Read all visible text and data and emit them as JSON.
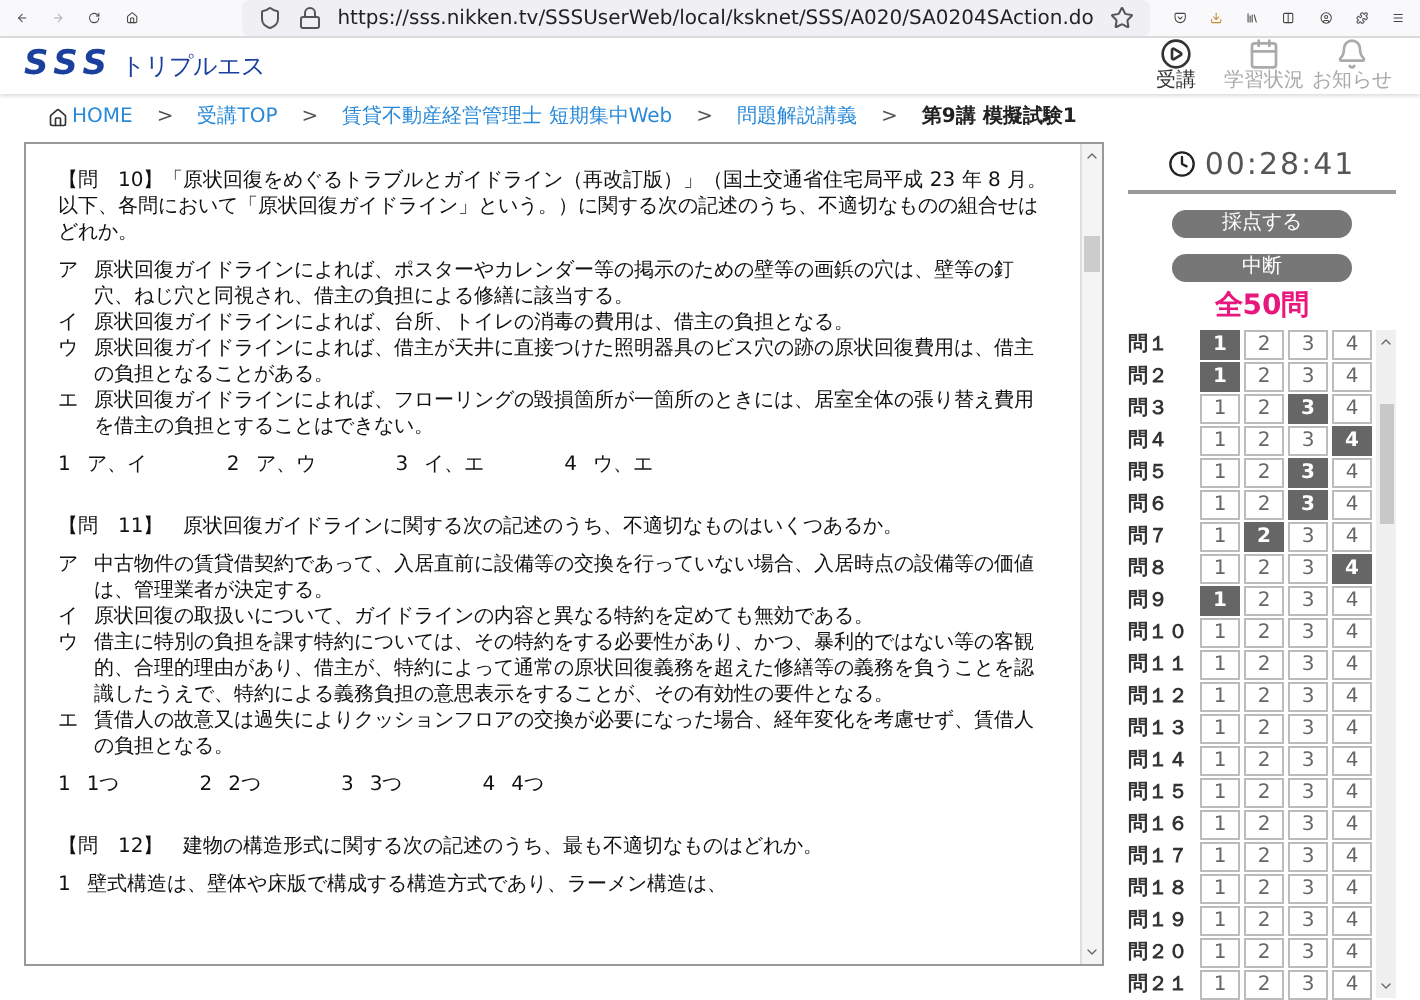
{
  "browser": {
    "url": "https://sss.nikken.tv/SSSUserWeb/local/ksknet/SSS/A020/SA0204SAction.do"
  },
  "header": {
    "logo_mark": "SSS",
    "logo_text": "トリプルエス",
    "nav": [
      {
        "label": "受講",
        "kind": "video",
        "disabled": false
      },
      {
        "label": "学習状況",
        "kind": "calendar",
        "disabled": true
      },
      {
        "label": "お知らせ",
        "kind": "bell",
        "disabled": true
      }
    ]
  },
  "breadcrumb": {
    "items": [
      {
        "label": "HOME",
        "kind": "home",
        "current": false
      },
      {
        "label": "受講TOP",
        "kind": "link",
        "current": false
      },
      {
        "label": "賃貸不動産経営管理士 短期集中Web",
        "kind": "link",
        "current": false
      },
      {
        "label": "問題解説講義",
        "kind": "link",
        "current": false
      },
      {
        "label": "第9講 模擬試験1",
        "kind": "link",
        "current": true
      }
    ],
    "separators": [
      ">",
      ">",
      ">",
      ">"
    ]
  },
  "document": {
    "questions": [
      {
        "prompt": "【問　10】「原状回復をめぐるトラブルとガイドライン（再改訂版）」（国土交通省住宅局平成 23 年 8 月。以下、各問において「原状回復ガイドライン」という。）に関する次の記述のうち、不適切なものの組合せはどれか。",
        "statements": [
          {
            "mark": "ア",
            "text": "原状回復ガイドラインによれば、ポスターやカレンダー等の掲示のための壁等の画鋲の穴は、壁等の釘穴、ねじ穴と同視され、借主の負担による修繕に該当する。"
          },
          {
            "mark": "イ",
            "text": "原状回復ガイドラインによれば、台所、トイレの消毒の費用は、借主の負担となる。"
          },
          {
            "mark": "ウ",
            "text": "原状回復ガイドラインによれば、借主が天井に直接つけた照明器具のビス穴の跡の原状回復費用は、借主の負担となることがある。"
          },
          {
            "mark": "エ",
            "text": "原状回復ガイドラインによれば、フローリングの毀損箇所が一箇所のときには、居室全体の張り替え費用を借主の負担とすることはできない。"
          }
        ],
        "options": [
          {
            "number": "1",
            "text": "ア、イ"
          },
          {
            "number": "2",
            "text": "ア、ウ"
          },
          {
            "number": "3",
            "text": "イ、エ"
          },
          {
            "number": "4",
            "text": "ウ、エ"
          }
        ]
      },
      {
        "prompt": "【問　11】　原状回復ガイドラインに関する次の記述のうち、不適切なものはいくつあるか。",
        "statements": [
          {
            "mark": "ア",
            "text": "中古物件の賃貸借契約であって、入居直前に設備等の交換を行っていない場合、入居時点の設備等の価値は、管理業者が決定する。"
          },
          {
            "mark": "イ",
            "text": "原状回復の取扱いについて、ガイドラインの内容と異なる特約を定めても無効である。"
          },
          {
            "mark": "ウ",
            "text": "借主に特別の負担を課す特約については、その特約をする必要性があり、かつ、暴利的ではない等の客観的、合理的理由があり、借主が、特約によって通常の原状回復義務を超えた修繕等の義務を負うことを認識したうえで、特約による義務負担の意思表示をすることが、その有効性の要件となる。"
          },
          {
            "mark": "エ",
            "text": "賃借人の故意又は過失によりクッションフロアの交換が必要になった場合、経年変化を考慮せず、賃借人の負担となる。"
          }
        ],
        "options": [
          {
            "number": "1",
            "text": "1つ"
          },
          {
            "number": "2",
            "text": "2つ"
          },
          {
            "number": "3",
            "text": "3つ"
          },
          {
            "number": "4",
            "text": "4つ"
          }
        ]
      },
      {
        "prompt": "【問　12】　建物の構造形式に関する次の記述のうち、最も不適切なものはどれか。",
        "options": [
          {
            "number": "1",
            "text": "壁式構造は、壁体や床版で構成する構造方式であり、ラーメン構造は、"
          }
        ]
      }
    ]
  },
  "timer": "00:28:41",
  "buttons": [
    {
      "label": "採点する"
    },
    {
      "label": "中断"
    }
  ],
  "total": "全50問",
  "answers": [
    {
      "label": "問１",
      "choices": [
        {
          "label": "1",
          "selected": true
        },
        {
          "label": "2",
          "selected": false
        },
        {
          "label": "3",
          "selected": false
        },
        {
          "label": "4",
          "selected": false
        }
      ]
    },
    {
      "label": "問２",
      "choices": [
        {
          "label": "1",
          "selected": true
        },
        {
          "label": "2",
          "selected": false
        },
        {
          "label": "3",
          "selected": false
        },
        {
          "label": "4",
          "selected": false
        }
      ]
    },
    {
      "label": "問３",
      "choices": [
        {
          "label": "1",
          "selected": false
        },
        {
          "label": "2",
          "selected": false
        },
        {
          "label": "3",
          "selected": true
        },
        {
          "label": "4",
          "selected": false
        }
      ]
    },
    {
      "label": "問４",
      "choices": [
        {
          "label": "1",
          "selected": false
        },
        {
          "label": "2",
          "selected": false
        },
        {
          "label": "3",
          "selected": false
        },
        {
          "label": "4",
          "selected": true
        }
      ]
    },
    {
      "label": "問５",
      "choices": [
        {
          "label": "1",
          "selected": false
        },
        {
          "label": "2",
          "selected": false
        },
        {
          "label": "3",
          "selected": true
        },
        {
          "label": "4",
          "selected": false
        }
      ]
    },
    {
      "label": "問６",
      "choices": [
        {
          "label": "1",
          "selected": false
        },
        {
          "label": "2",
          "selected": false
        },
        {
          "label": "3",
          "selected": true
        },
        {
          "label": "4",
          "selected": false
        }
      ]
    },
    {
      "label": "問７",
      "choices": [
        {
          "label": "1",
          "selected": false
        },
        {
          "label": "2",
          "selected": true
        },
        {
          "label": "3",
          "selected": false
        },
        {
          "label": "4",
          "selected": false
        }
      ]
    },
    {
      "label": "問８",
      "choices": [
        {
          "label": "1",
          "selected": false
        },
        {
          "label": "2",
          "selected": false
        },
        {
          "label": "3",
          "selected": false
        },
        {
          "label": "4",
          "selected": true
        }
      ]
    },
    {
      "label": "問９",
      "choices": [
        {
          "label": "1",
          "selected": true
        },
        {
          "label": "2",
          "selected": false
        },
        {
          "label": "3",
          "selected": false
        },
        {
          "label": "4",
          "selected": false
        }
      ]
    },
    {
      "label": "問１０",
      "choices": [
        {
          "label": "1",
          "selected": false
        },
        {
          "label": "2",
          "selected": false
        },
        {
          "label": "3",
          "selected": false
        },
        {
          "label": "4",
          "selected": false
        }
      ]
    },
    {
      "label": "問１１",
      "choices": [
        {
          "label": "1",
          "selected": false
        },
        {
          "label": "2",
          "selected": false
        },
        {
          "label": "3",
          "selected": false
        },
        {
          "label": "4",
          "selected": false
        }
      ]
    },
    {
      "label": "問１２",
      "choices": [
        {
          "label": "1",
          "selected": false
        },
        {
          "label": "2",
          "selected": false
        },
        {
          "label": "3",
          "selected": false
        },
        {
          "label": "4",
          "selected": false
        }
      ]
    },
    {
      "label": "問１３",
      "choices": [
        {
          "label": "1",
          "selected": false
        },
        {
          "label": "2",
          "selected": false
        },
        {
          "label": "3",
          "selected": false
        },
        {
          "label": "4",
          "selected": false
        }
      ]
    },
    {
      "label": "問１４",
      "choices": [
        {
          "label": "1",
          "selected": false
        },
        {
          "label": "2",
          "selected": false
        },
        {
          "label": "3",
          "selected": false
        },
        {
          "label": "4",
          "selected": false
        }
      ]
    },
    {
      "label": "問１５",
      "choices": [
        {
          "label": "1",
          "selected": false
        },
        {
          "label": "2",
          "selected": false
        },
        {
          "label": "3",
          "selected": false
        },
        {
          "label": "4",
          "selected": false
        }
      ]
    },
    {
      "label": "問１６",
      "choices": [
        {
          "label": "1",
          "selected": false
        },
        {
          "label": "2",
          "selected": false
        },
        {
          "label": "3",
          "selected": false
        },
        {
          "label": "4",
          "selected": false
        }
      ]
    },
    {
      "label": "問１７",
      "choices": [
        {
          "label": "1",
          "selected": false
        },
        {
          "label": "2",
          "selected": false
        },
        {
          "label": "3",
          "selected": false
        },
        {
          "label": "4",
          "selected": false
        }
      ]
    },
    {
      "label": "問１８",
      "choices": [
        {
          "label": "1",
          "selected": false
        },
        {
          "label": "2",
          "selected": false
        },
        {
          "label": "3",
          "selected": false
        },
        {
          "label": "4",
          "selected": false
        }
      ]
    },
    {
      "label": "問１９",
      "choices": [
        {
          "label": "1",
          "selected": false
        },
        {
          "label": "2",
          "selected": false
        },
        {
          "label": "3",
          "selected": false
        },
        {
          "label": "4",
          "selected": false
        }
      ]
    },
    {
      "label": "問２０",
      "choices": [
        {
          "label": "1",
          "selected": false
        },
        {
          "label": "2",
          "selected": false
        },
        {
          "label": "3",
          "selected": false
        },
        {
          "label": "4",
          "selected": false
        }
      ]
    },
    {
      "label": "問２１",
      "choices": [
        {
          "label": "1",
          "selected": false
        },
        {
          "label": "2",
          "selected": false
        },
        {
          "label": "3",
          "selected": false
        },
        {
          "label": "4",
          "selected": false
        }
      ]
    }
  ]
}
